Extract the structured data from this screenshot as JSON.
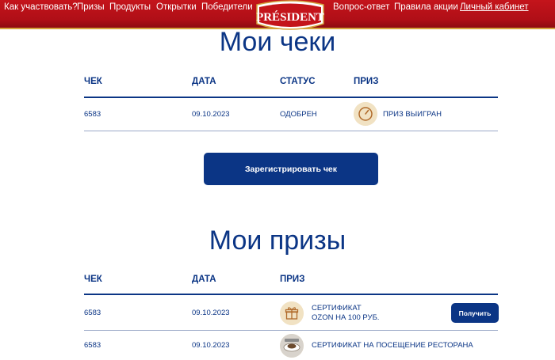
{
  "nav": {
    "items": [
      "Как участвовать?",
      "Призы",
      "Продукты",
      "Открытки",
      "Победители",
      "Вопрос-ответ",
      "Правила акции",
      "Личный кабинет"
    ],
    "logo_text": "PRÉSIDENT"
  },
  "checks": {
    "title": "Мои чеки",
    "headers": {
      "check": "ЧЕК",
      "date": "ДАТА",
      "status": "СТАТУС",
      "prize": "ПРИЗ"
    },
    "rows": [
      {
        "check": "6583",
        "date": "09.10.2023",
        "status": "ОДОБРЕН",
        "prize": "ПРИЗ ВЫИГРАН",
        "icon": "clock-icon"
      }
    ],
    "register_button": "Зарегистрировать чек"
  },
  "prizes": {
    "title": "Мои призы",
    "headers": {
      "check": "ЧЕК",
      "date": "ДАТА",
      "prize": "ПРИЗ"
    },
    "rows": [
      {
        "check": "6583",
        "date": "09.10.2023",
        "prize_line1": "СЕРТИФИКАТ",
        "prize_line2": "OZON НА 100 РУБ.",
        "icon": "gift-icon",
        "button": "Получить"
      },
      {
        "check": "6583",
        "date": "09.10.2023",
        "prize_line1": "СЕРТИФИКАТ НА ПОСЕЩЕНИЕ РЕСТОРАНА",
        "icon": "restaurant-dish-icon"
      }
    ]
  },
  "colors": {
    "brand_red": "#c4141b",
    "navy": "#0b3585",
    "gold": "#d4a23b",
    "icon_bg": "#f1e2c3"
  }
}
